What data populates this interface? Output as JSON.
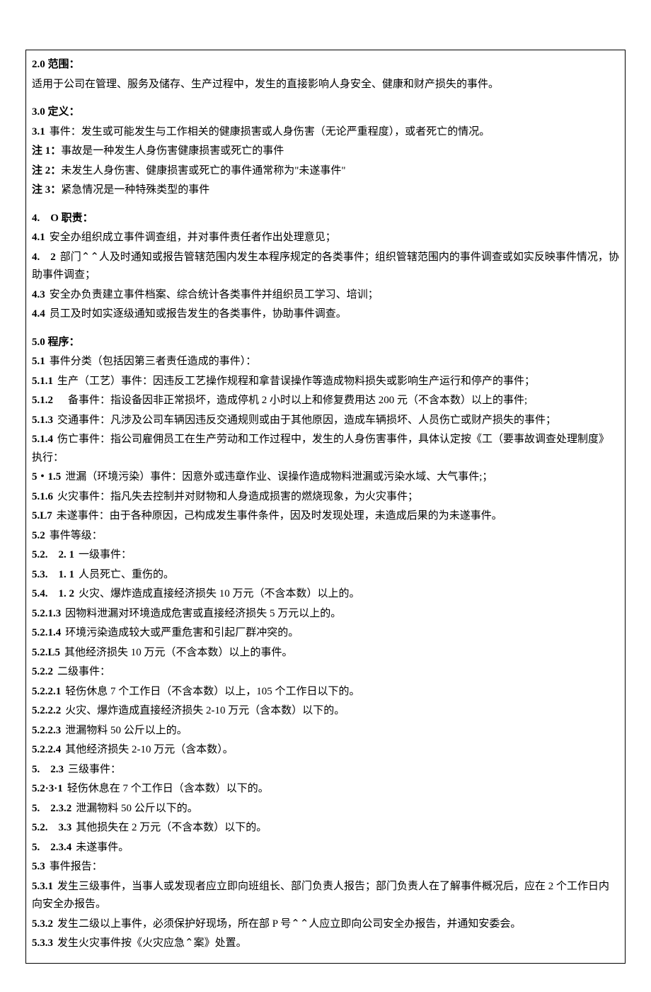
{
  "section2": {
    "heading_num": "2.0",
    "heading_text": "范围：",
    "body": "适用于公司在管理、服务及储存、生产过程中，发生的直接影响人身安全、健康和财产损失的事件。"
  },
  "section3": {
    "heading_num": "3.0",
    "heading_text": "定义：",
    "item1_num": "3.1",
    "item1_text": "事件：发生或可能发生与工作相关的健康损害或人身伤害（无论严重程度），或者死亡的情况。",
    "note1_num": "注 1：",
    "note1_text": "事故是一种发生人身伤害健康损害或死亡的事件",
    "note2_num": "注 2：",
    "note2_text": "未发生人身伤害、健康损害或死亡的事件通常称为\"未遂事件\"",
    "note3_num": "注 3：",
    "note3_text": "紧急情况是一种特殊类型的事件"
  },
  "section4": {
    "heading_num": "4.　O",
    "heading_text": "职责：",
    "item1_num": "4.1",
    "item1_text": "安全办组织成立事件调查组，并对事件责任者作出处理意见；",
    "item2_num": "4.　2",
    "item2_text": "部门⌃⌃人及时通知或报告管辖范围内发生本程序规定的各类事件；组织管辖范围内的事件调查或如实反映事件情况，协助事件调查；",
    "item3_num": "4.3",
    "item3_text": "安全办负责建立事件档案、综合统计各类事件并组织员工学习、培训；",
    "item4_num": "4.4",
    "item4_text": "员工及时如实逐级通知或报告发生的各类事件，协助事件调查。"
  },
  "section5": {
    "heading_num": "5.0",
    "heading_text": "程序：",
    "s51_num": "5.1",
    "s51_text": "事件分类（包括因第三者责任造成的事件）：",
    "s511_num": "5.1.1",
    "s511_text": "生产（工艺）事件：因违反工艺操作规程和拿昔误操作等造成物料损失或影响生产运行和停产的事件；",
    "s512_num": "5.1.2",
    "s512_text": "备事件：指设备因非正常损坏，造成停机 2 小时以上和修复费用达 200 元（不含本数）以上的事件;",
    "s513_num": "5.1.3",
    "s513_text": "交通事件：凡涉及公司车辆因违反交通规则或由于其他原因，造成车辆损坏、人员伤亡或财产损失的事件；",
    "s514_num": "5.1.4",
    "s514_text": "伤亡事件：指公司雇佣员工在生产劳动和工作过程中，发生的人身伤害事件，具体认定按《工（要事故调查处理制度》执行：",
    "s515_num": "5・1.5",
    "s515_text": "泄漏（环境污染）事件：因意外或违章作业、误操作造成物料泄漏或污染水域、大气事件;；",
    "s516_num": "5.1.6",
    "s516_text": "火灾事件：指凡失去控制并对财物和人身造成损害的燃烧现象，为火灾事件；",
    "s517_num": "5.L7",
    "s517_text": "未遂事件：由于各种原因，己构成发生事件条件，因及时发现处理，未造成后果的为未遂事件。",
    "s52_num": "5.2",
    "s52_text": "事件等级：",
    "s521_num": "5.2.　2. 1",
    "s521_text": "一级事件：",
    "s5211_num": "5.3.　1. 1",
    "s5211_text": "人员死亡、重伤的。",
    "s5212_num": "5.4.　1. 2",
    "s5212_text": "火灾、爆炸造成直接经济损失 10 万元（不含本数）以上的。",
    "s5213_num": "5.2.1.3",
    "s5213_text": "因物料泄漏对环境造成危害或直接经济损失 5 万元以上的。",
    "s5214_num": "5.2.1.4",
    "s5214_text": "环境污染造成较大或严重危害和引起厂群冲突的。",
    "s5215_num": "5.2.L5",
    "s5215_text": "其他经济损失 10 万元（不含本数）以上的事件。",
    "s522_num": "5.2.2",
    "s522_text": "二级事件：",
    "s5221_num": "5.2.2.1",
    "s5221_text": "轻伤休息 7 个工作日（不含本数）以上，105 个工作日以下的。",
    "s5222_num": "5.2.2.2",
    "s5222_text": "火灾、爆炸造成直接经济损失 2-10 万元（含本数）以下的。",
    "s5223_num": "5.2.2.3",
    "s5223_text": "泄漏物料 50 公斤以上的。",
    "s5224_num": "5.2.2.4",
    "s5224_text": "其他经济损失 2-10 万元（含本数）。",
    "s523_num": "5.　2.3",
    "s523_text": "三级事件：",
    "s5231_num": "5.2·3·1",
    "s5231_text": "轻伤休息在 7 个工作日（含本数）以下的。",
    "s5232_num": "5.　2.3.2",
    "s5232_text": "泄漏物料 50 公斤以下的。",
    "s5233_num": "5.2.　3.3",
    "s5233_text": "其他损失在 2 万元（不含本数）以下的。",
    "s5234_num": "5.　2.3.4",
    "s5234_text": "未遂事件。",
    "s53_num": "5.3",
    "s53_text": "事件报告：",
    "s531_num": "5.3.1",
    "s531_text": "发生三级事件，当事人或发现者应立即向班组长、部门负责人报告；部门负责人在了解事件概况后，应在 2 个工作日内向安全办报告。",
    "s532_num": "5.3.2",
    "s532_text": "发生二级以上事件，必须保护好现场，所在部 P 号⌃⌃人应立即向公司安全办报告，并通知安委会。",
    "s533_num": "5.3.3",
    "s533_text": "发生火灾事件按《火灾应急⌃案》处置。"
  }
}
